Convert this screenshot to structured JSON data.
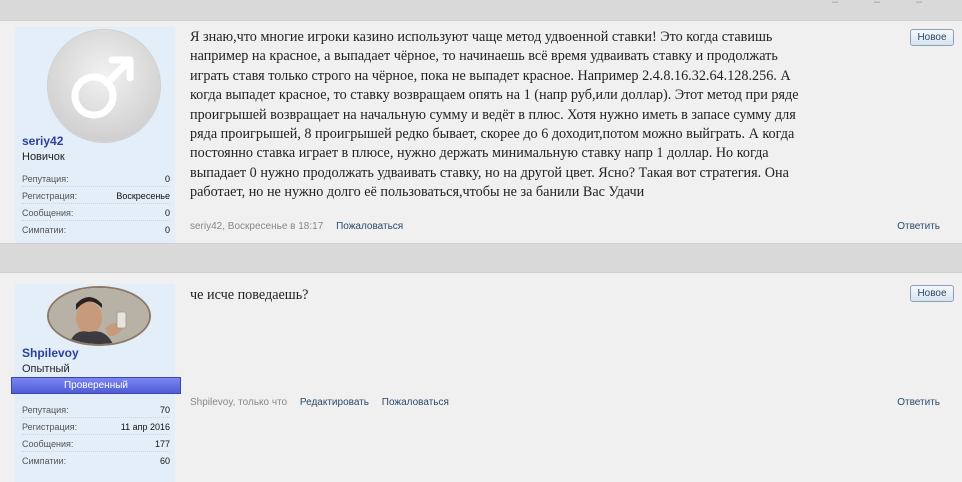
{
  "posts": [
    {
      "username": "seriy42",
      "user_title": "Новичок",
      "avatar_icon": "male-symbol-icon",
      "stats": [
        {
          "label": "Репутация:",
          "value": "0"
        },
        {
          "label": "Регистрация:",
          "value": "Воскресенье"
        },
        {
          "label": "Сообщения:",
          "value": "0"
        },
        {
          "label": "Симпатии:",
          "value": "0"
        }
      ],
      "lines": [
        "Я знаю,что многие игроки казино используют чаще метод удвоенной ставки! Это когда ставишь",
        "например на красное, а выпадает чёрное, то начинаешь всё время удваивать ставку и продолжать",
        "играть ставя только строго на чёрное, пока не выпадет красное. Например 2.4.8.16.32.64.128.256. А",
        "когда выпадет красное, то ставку возвращаем опять на 1 (напр руб,или доллар). Этот метод при ряде",
        "проигрышей возвращает на начальную сумму и ведёт в плюс. Хотя нужно иметь в запасе сумму для",
        "ряда проигрышей, 8 проигрышей редко бывает, скорее до 6 доходит,потом можно выйграть. А когда",
        "постоянно ставка играет в плюсе, нужно держать минимальную ставку напр 1 доллар. Но когда",
        "выпадает 0 нужно продолжать удваивать ставку, но на другой цвет. Ясно? Такая вот стратегия. Она",
        "работает, но не нужно долго её пользоваться,чтобы не за банили Вас Удачи"
      ],
      "meta": "seriy42, Воскресенье в 18:17",
      "actions": [
        "Пожаловаться"
      ],
      "reply": "Ответить",
      "new_badge": "Новое"
    },
    {
      "username": "Shpilevoy",
      "user_title": "Опытный",
      "verified": "Проверенный",
      "avatar_icon": "user-photo-avatar",
      "stats": [
        {
          "label": "Репутация:",
          "value": "70"
        },
        {
          "label": "Регистрация:",
          "value": "11 апр 2016"
        },
        {
          "label": "Сообщения:",
          "value": "177"
        },
        {
          "label": "Симпатии:",
          "value": "60"
        }
      ],
      "lines": [
        "че исче поведаешь?"
      ],
      "meta": "Shpilevoy, только что",
      "actions": [
        "Редактировать",
        "Пожаловаться"
      ],
      "reply": "Ответить",
      "new_badge": "Новое"
    }
  ]
}
